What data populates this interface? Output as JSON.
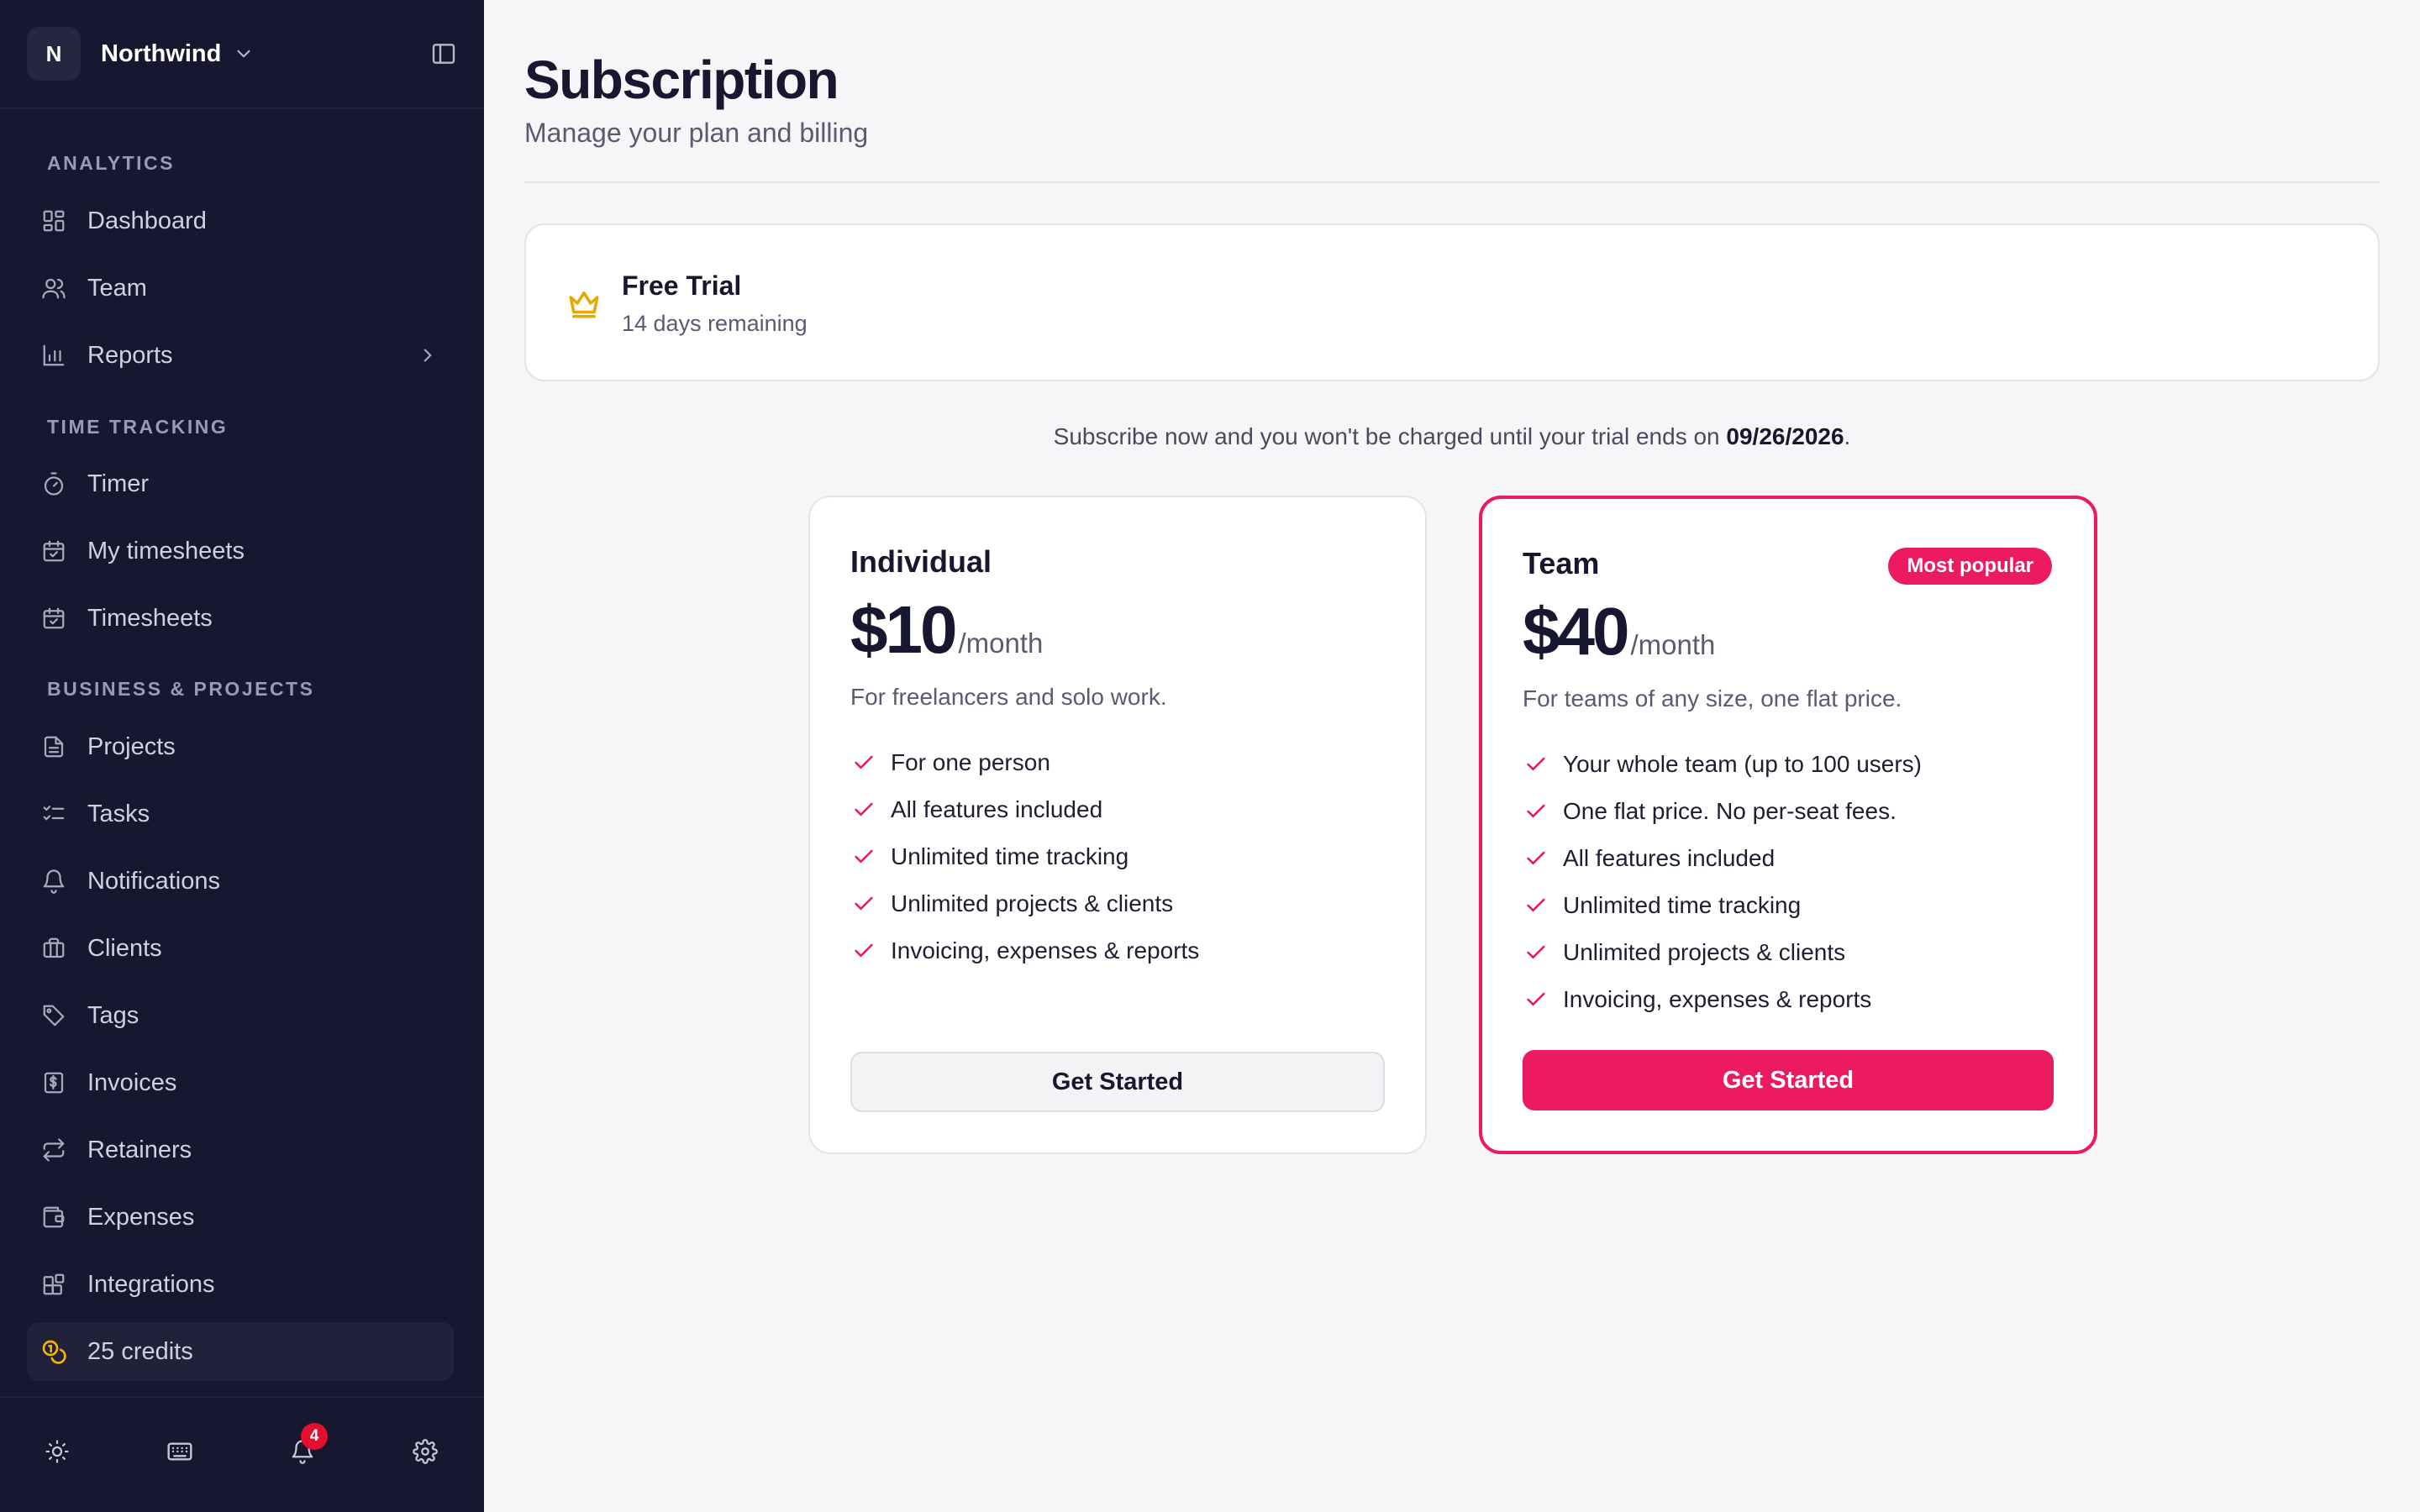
{
  "workspace": {
    "initial": "N",
    "name": "Northwind"
  },
  "sidebar": {
    "sections": [
      {
        "label": "ANALYTICS",
        "items": [
          {
            "label": "Dashboard",
            "icon": "dashboard-icon"
          },
          {
            "label": "Team",
            "icon": "users-icon"
          },
          {
            "label": "Reports",
            "icon": "bar-chart-icon"
          }
        ]
      },
      {
        "label": "TIME TRACKING",
        "items": [
          {
            "label": "Timer",
            "icon": "stopwatch-icon"
          },
          {
            "label": "My timesheets",
            "icon": "calendar-check-icon"
          },
          {
            "label": "Timesheets",
            "icon": "calendar-check-icon"
          }
        ]
      },
      {
        "label": "BUSINESS & PROJECTS",
        "items": [
          {
            "label": "Projects",
            "icon": "document-icon"
          },
          {
            "label": "Tasks",
            "icon": "checklist-icon"
          },
          {
            "label": "Notifications",
            "icon": "bell-icon"
          },
          {
            "label": "Clients",
            "icon": "briefcase-icon"
          },
          {
            "label": "Tags",
            "icon": "tag-icon"
          },
          {
            "label": "Invoices",
            "icon": "invoice-icon"
          },
          {
            "label": "Retainers",
            "icon": "repeat-icon"
          },
          {
            "label": "Expenses",
            "icon": "wallet-icon"
          },
          {
            "label": "Integrations",
            "icon": "integrations-icon"
          }
        ]
      }
    ],
    "credits": {
      "label": "25 credits",
      "icon": "coins-icon",
      "color": "#f5b400"
    },
    "footer": {
      "notification_count": "4"
    }
  },
  "header": {
    "title": "Subscription",
    "subtitle": "Manage your plan and billing"
  },
  "trial": {
    "title": "Free Trial",
    "subtitle": "14 days remaining",
    "icon": "crown-icon",
    "icon_color": "#e8a800"
  },
  "notice": {
    "prefix": "Subscribe now and you won't be charged until your trial ends on ",
    "date": "09/26/2026",
    "suffix": "."
  },
  "plans": [
    {
      "name": "Individual",
      "price": "$10",
      "period": "/month",
      "description": "For freelancers and solo work.",
      "features": [
        "For one person",
        "All features included",
        "Unlimited time tracking",
        "Unlimited projects & clients",
        "Invoicing, expenses & reports"
      ],
      "cta": "Get Started"
    },
    {
      "name": "Team",
      "badge": "Most popular",
      "price": "$40",
      "period": "/month",
      "description": "For teams of any size, one flat price.",
      "features": [
        "Your whole team (up to 100 users)",
        "One flat price. No per-seat fees.",
        "All features included",
        "Unlimited time tracking",
        "Unlimited projects & clients",
        "Invoicing, expenses & reports"
      ],
      "cta": "Get Started"
    }
  ],
  "colors": {
    "accent": "#ec1a63",
    "sidebar_bg": "#17172f",
    "badge": "#e0102e"
  }
}
